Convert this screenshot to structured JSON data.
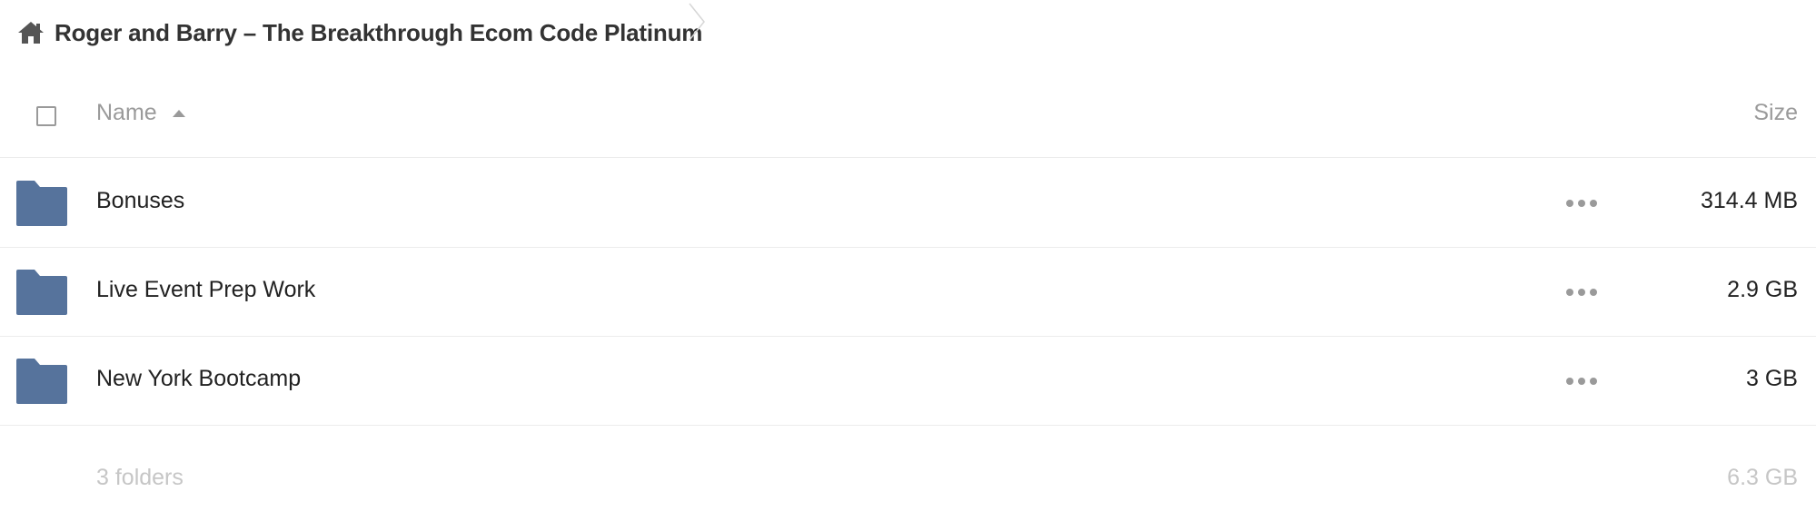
{
  "breadcrumb": {
    "home_icon": "home-icon",
    "current": "Roger and Barry – The Breakthrough Ecom Code Platinum"
  },
  "table": {
    "header": {
      "name_label": "Name",
      "size_label": "Size",
      "sort_direction": "ascending"
    },
    "rows": [
      {
        "icon": "folder-icon",
        "name": "Bonuses",
        "size": "314.4 MB"
      },
      {
        "icon": "folder-icon",
        "name": "Live Event Prep Work",
        "size": "2.9 GB"
      },
      {
        "icon": "folder-icon",
        "name": "New York Bootcamp",
        "size": "3 GB"
      }
    ],
    "summary": {
      "count": "3 folders",
      "total_size": "6.3 GB"
    }
  },
  "colors": {
    "folder": "#56739c",
    "muted_text": "#9a9a9a",
    "faint_text": "#c6c6c6",
    "divider": "#ececec"
  }
}
